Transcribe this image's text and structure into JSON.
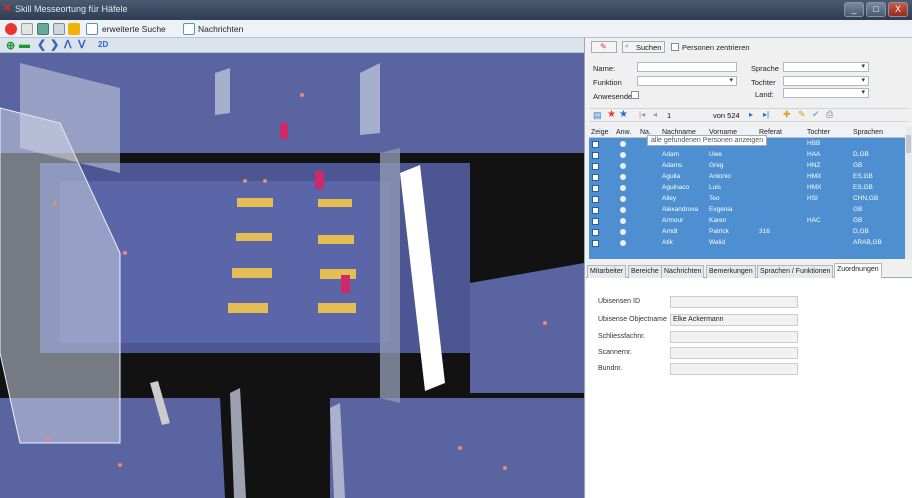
{
  "window": {
    "title": "Skill Messeortung für Häfele",
    "minimize": "_",
    "maximize": "□",
    "close": "X"
  },
  "toolbar": {
    "extended_search": "erweiterte Suche",
    "messages": "Nachrichten"
  },
  "view3d": {
    "mode_label": "2D"
  },
  "search": {
    "search_button": "Suchen",
    "center_persons": "Personen zentrieren",
    "name_label": "Name:",
    "function_label": "Funktion",
    "present_label": "Anwesende",
    "language_label": "Sprache",
    "subsidiary_label": "Tochter",
    "country_label": "Land:"
  },
  "navigator": {
    "position": "1",
    "of_total": "von 524"
  },
  "grid": {
    "tooltip": "alle gefundenen Personen anzeigen",
    "headers": [
      "Zeige",
      "Anw.",
      "Na.",
      "Nachname",
      "Vorname",
      "Referat",
      "Tochter",
      "Sprachen"
    ],
    "rows": [
      {
        "last": "",
        "first": "",
        "ref": "",
        "sub": "HBB",
        "lang": ""
      },
      {
        "last": "Adam",
        "first": "Uwe",
        "ref": "",
        "sub": "HAA",
        "lang": "D,GB"
      },
      {
        "last": "Adams",
        "first": "Greg",
        "ref": "",
        "sub": "HNZ",
        "lang": "GB"
      },
      {
        "last": "Aguila",
        "first": "Antonio",
        "ref": "",
        "sub": "HMX",
        "lang": "ES,GB"
      },
      {
        "last": "Aguinaco",
        "first": "Luis",
        "ref": "",
        "sub": "HMX",
        "lang": "ES,GB"
      },
      {
        "last": "Alley",
        "first": "Teo",
        "ref": "",
        "sub": "HSI",
        "lang": "CHN,GB"
      },
      {
        "last": "Alexandrova",
        "first": "Evgenia",
        "ref": "",
        "sub": "",
        "lang": "GB"
      },
      {
        "last": "Armour",
        "first": "Karen",
        "ref": "",
        "sub": "HAC",
        "lang": "GB"
      },
      {
        "last": "Arndt",
        "first": "Patrick",
        "ref": "316",
        "sub": "",
        "lang": "D,GB"
      },
      {
        "last": "Atik",
        "first": "Walid",
        "ref": "",
        "sub": "",
        "lang": "ARAB,GB"
      }
    ]
  },
  "tabs": [
    "Mitarbeiter",
    "Bereiche",
    "Nachrichten",
    "Bemerkungen",
    "Sprachen / Funktionen",
    "Zuordnungen"
  ],
  "detail": {
    "ubisense_id_label": "Ubisensen ID",
    "object_name_label": "Ubisense Objectname",
    "object_name_value": "Elke Ackermann",
    "locker_label": "Schliessfachnr.",
    "scanner_label": "Scannernr.",
    "bund_label": "Bundnr."
  },
  "colors": {
    "floor": "#4e5a93",
    "grid_selection": "#4d8fd0",
    "title_bar": "#2f3d52",
    "accent": "#e22"
  }
}
